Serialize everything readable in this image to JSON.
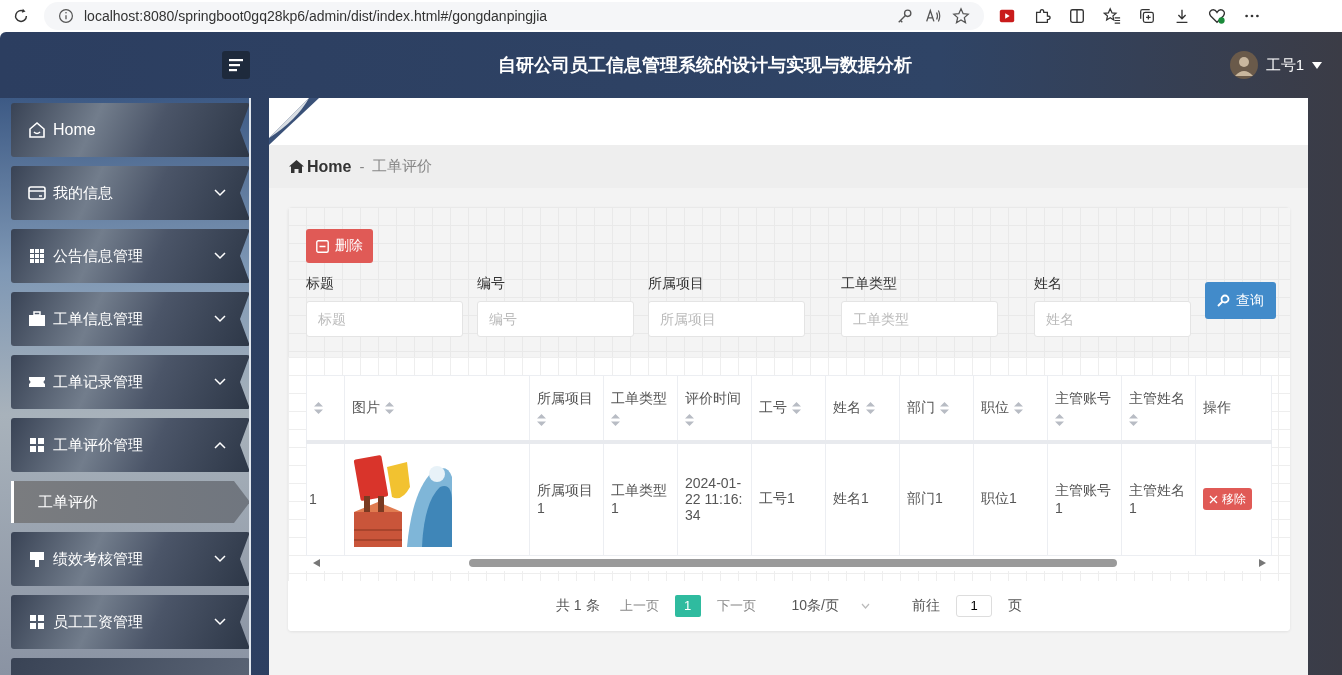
{
  "browser": {
    "url": "localhost:8080/springboot0gq28kp6/admin/dist/index.html#/gongdanpingjia"
  },
  "header": {
    "title": "自研公司员工信息管理系统的设计与实现与数据分析",
    "user": "工号1"
  },
  "sidebar": {
    "items": [
      {
        "label": "Home",
        "kind": "link"
      },
      {
        "label": "我的信息",
        "kind": "menu",
        "expanded": false
      },
      {
        "label": "公告信息管理",
        "kind": "menu",
        "expanded": false
      },
      {
        "label": "工单信息管理",
        "kind": "menu",
        "expanded": false
      },
      {
        "label": "工单记录管理",
        "kind": "menu",
        "expanded": false
      },
      {
        "label": "工单评价管理",
        "kind": "menu",
        "expanded": true,
        "children": [
          {
            "label": "工单评价",
            "selected": true
          }
        ]
      },
      {
        "label": "绩效考核管理",
        "kind": "menu",
        "expanded": false
      },
      {
        "label": "员工工资管理",
        "kind": "menu",
        "expanded": false
      }
    ]
  },
  "breadcrumb": {
    "home": "Home",
    "separator": "-",
    "current": "工单评价"
  },
  "toolbar": {
    "delete_button": "删除",
    "search_button": "查询",
    "filters": [
      {
        "label": "标题",
        "placeholder": "标题"
      },
      {
        "label": "编号",
        "placeholder": "编号"
      },
      {
        "label": "所属项目",
        "placeholder": "所属项目"
      },
      {
        "label": "工单类型",
        "placeholder": "工单类型"
      },
      {
        "label": "姓名",
        "placeholder": "姓名"
      }
    ]
  },
  "table": {
    "columns": [
      {
        "sortable": true
      },
      {
        "label": "图片",
        "sortable": true
      },
      {
        "label": "所属项目",
        "sortable": true
      },
      {
        "label": "工单类型",
        "sortable": true
      },
      {
        "label": "评价时间",
        "sortable": true
      },
      {
        "label": "工号",
        "sortable": true
      },
      {
        "label": "姓名",
        "sortable": true
      },
      {
        "label": "部门",
        "sortable": true
      },
      {
        "label": "职位",
        "sortable": true
      },
      {
        "label": "主管账号",
        "sortable": true
      },
      {
        "label": "主管姓名",
        "sortable": true
      },
      {
        "label": "操作",
        "sortable": false
      }
    ],
    "rows": [
      {
        "cells": [
          "1",
          {
            "kind": "picture"
          },
          "所属项目1",
          "工单类型1",
          "2024-01-22 11:16:34",
          "工号1",
          "姓名1",
          "部门1",
          "职位1",
          "主管账号1",
          "主管姓名1"
        ],
        "action": "移除"
      }
    ]
  },
  "pagination": {
    "total": "共 1 条",
    "prev": "上一页",
    "pages": [
      {
        "label": "1",
        "selected": true
      }
    ],
    "next": "下一页",
    "page_size": "10条/页",
    "goto_label": "前往",
    "goto_value": "1",
    "goto_suffix": "页"
  }
}
